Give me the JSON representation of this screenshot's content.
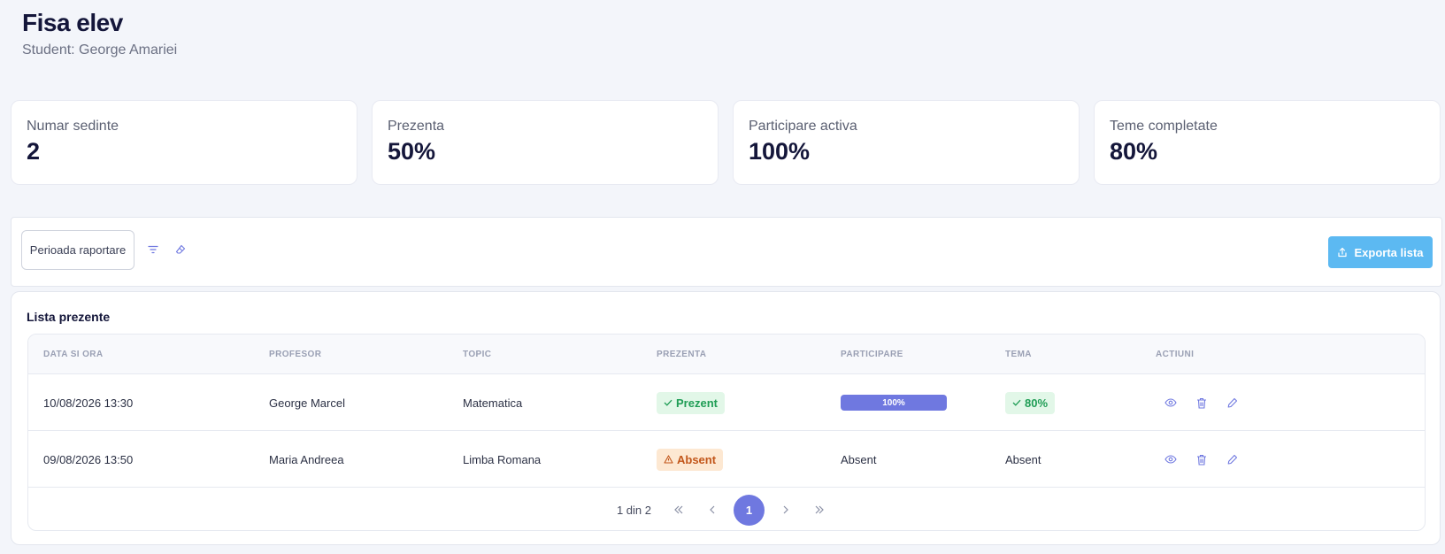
{
  "header": {
    "title": "Fisa elev",
    "subtitle": "Student: George Amariei"
  },
  "stats": [
    {
      "label": "Numar sedinte",
      "value": "2"
    },
    {
      "label": "Prezenta",
      "value": "50%"
    },
    {
      "label": "Participare activa",
      "value": "100%"
    },
    {
      "label": "Teme completate",
      "value": "80%"
    }
  ],
  "filters": {
    "period_label": "Perioada raportare",
    "export_label": "Exporta lista"
  },
  "list": {
    "title": "Lista prezente",
    "columns": [
      "DATA SI ORA",
      "PROFESOR",
      "TOPIC",
      "PREZENTA",
      "PARTICIPARE",
      "TEMA",
      "ACTIUNI"
    ],
    "rows": [
      {
        "date": "10/08/2026 13:30",
        "teacher": "George Marcel",
        "topic": "Matematica",
        "presence": "Prezent",
        "participation": "100%",
        "participation_fraction": 1.0,
        "homework": "80%"
      },
      {
        "date": "09/08/2026 13:50",
        "teacher": "Maria Andreea",
        "topic": "Limba Romana",
        "presence": "Absent",
        "participation": "Absent",
        "homework": "Absent"
      }
    ],
    "pagination": {
      "info": "1 din 2",
      "current": "1"
    }
  },
  "colors": {
    "accent": "#6f78e0",
    "export": "#5cb9f2",
    "success": "#1f9d55",
    "warning": "#c2561a"
  }
}
